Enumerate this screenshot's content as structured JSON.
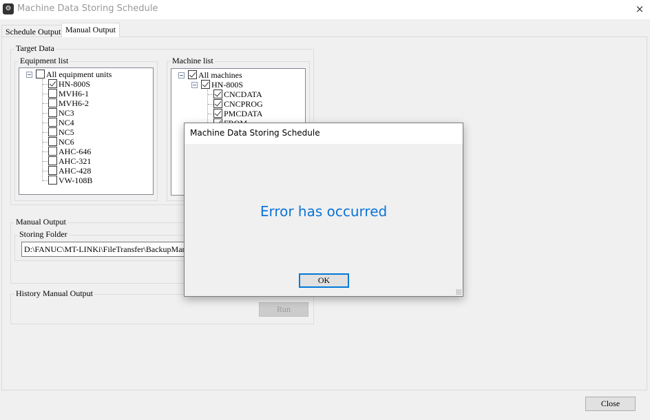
{
  "window": {
    "title": "Machine Data Storing Schedule",
    "close_icon": "×",
    "app_icon": "machine-icon"
  },
  "tabs": [
    {
      "label": "Schedule Output",
      "active": false
    },
    {
      "label": "Manual Output",
      "active": true
    }
  ],
  "target_data": {
    "label": "Target Data",
    "equipment_list": {
      "label": "Equipment list",
      "root": {
        "label": "All equipment units",
        "checked": false,
        "expanded": true
      },
      "items": [
        {
          "label": "HN-800S",
          "checked": true
        },
        {
          "label": "MVH6-1",
          "checked": false
        },
        {
          "label": "MVH6-2",
          "checked": false
        },
        {
          "label": "NC3",
          "checked": false
        },
        {
          "label": "NC4",
          "checked": false
        },
        {
          "label": "NC5",
          "checked": false
        },
        {
          "label": "NC6",
          "checked": false
        },
        {
          "label": "AHC-646",
          "checked": false
        },
        {
          "label": "AHC-321",
          "checked": false
        },
        {
          "label": "AHC-428",
          "checked": false
        },
        {
          "label": "VW-108B",
          "checked": false
        }
      ]
    },
    "machine_list": {
      "label": "Machine list",
      "root": {
        "label": "All machines",
        "checked": true,
        "expanded": true
      },
      "machine": {
        "label": "HN-800S",
        "checked": true,
        "expanded": true
      },
      "items": [
        {
          "label": "CNCDATA",
          "checked": true
        },
        {
          "label": "CNCPROG",
          "checked": true
        },
        {
          "label": "PMCDATA",
          "checked": true
        },
        {
          "label": "FROM",
          "checked": true
        }
      ]
    }
  },
  "manual_output": {
    "label": "Manual Output",
    "storing_folder": {
      "label": "Storing Folder",
      "value": "D:\\FANUC\\MT-LINKi\\FileTransfer\\BackupManual"
    }
  },
  "history": {
    "label": "History Manual Output",
    "run_label": "Run",
    "run_enabled": false
  },
  "footer": {
    "close_label": "Close"
  },
  "dialog": {
    "title": "Machine Data Storing Schedule",
    "message": "Error has occurred",
    "ok_label": "OK",
    "message_color": "#0a74d6"
  }
}
